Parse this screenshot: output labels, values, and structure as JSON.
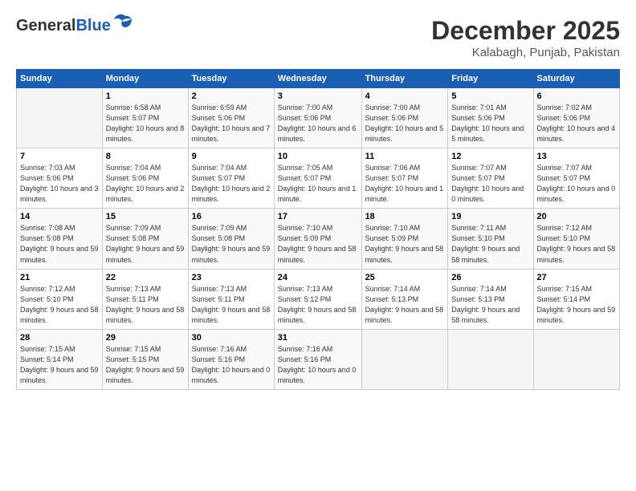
{
  "header": {
    "logo_general": "General",
    "logo_blue": "Blue",
    "month": "December 2025",
    "location": "Kalabagh, Punjab, Pakistan"
  },
  "days_of_week": [
    "Sunday",
    "Monday",
    "Tuesday",
    "Wednesday",
    "Thursday",
    "Friday",
    "Saturday"
  ],
  "weeks": [
    [
      {
        "num": "",
        "empty": true
      },
      {
        "num": "1",
        "sunrise": "Sunrise: 6:58 AM",
        "sunset": "Sunset: 5:07 PM",
        "daylight": "Daylight: 10 hours and 8 minutes."
      },
      {
        "num": "2",
        "sunrise": "Sunrise: 6:59 AM",
        "sunset": "Sunset: 5:06 PM",
        "daylight": "Daylight: 10 hours and 7 minutes."
      },
      {
        "num": "3",
        "sunrise": "Sunrise: 7:00 AM",
        "sunset": "Sunset: 5:06 PM",
        "daylight": "Daylight: 10 hours and 6 minutes."
      },
      {
        "num": "4",
        "sunrise": "Sunrise: 7:00 AM",
        "sunset": "Sunset: 5:06 PM",
        "daylight": "Daylight: 10 hours and 5 minutes."
      },
      {
        "num": "5",
        "sunrise": "Sunrise: 7:01 AM",
        "sunset": "Sunset: 5:06 PM",
        "daylight": "Daylight: 10 hours and 5 minutes."
      },
      {
        "num": "6",
        "sunrise": "Sunrise: 7:02 AM",
        "sunset": "Sunset: 5:06 PM",
        "daylight": "Daylight: 10 hours and 4 minutes."
      }
    ],
    [
      {
        "num": "7",
        "sunrise": "Sunrise: 7:03 AM",
        "sunset": "Sunset: 5:06 PM",
        "daylight": "Daylight: 10 hours and 3 minutes."
      },
      {
        "num": "8",
        "sunrise": "Sunrise: 7:04 AM",
        "sunset": "Sunset: 5:06 PM",
        "daylight": "Daylight: 10 hours and 2 minutes."
      },
      {
        "num": "9",
        "sunrise": "Sunrise: 7:04 AM",
        "sunset": "Sunset: 5:07 PM",
        "daylight": "Daylight: 10 hours and 2 minutes."
      },
      {
        "num": "10",
        "sunrise": "Sunrise: 7:05 AM",
        "sunset": "Sunset: 5:07 PM",
        "daylight": "Daylight: 10 hours and 1 minute."
      },
      {
        "num": "11",
        "sunrise": "Sunrise: 7:06 AM",
        "sunset": "Sunset: 5:07 PM",
        "daylight": "Daylight: 10 hours and 1 minute."
      },
      {
        "num": "12",
        "sunrise": "Sunrise: 7:07 AM",
        "sunset": "Sunset: 5:07 PM",
        "daylight": "Daylight: 10 hours and 0 minutes."
      },
      {
        "num": "13",
        "sunrise": "Sunrise: 7:07 AM",
        "sunset": "Sunset: 5:07 PM",
        "daylight": "Daylight: 10 hours and 0 minutes."
      }
    ],
    [
      {
        "num": "14",
        "sunrise": "Sunrise: 7:08 AM",
        "sunset": "Sunset: 5:08 PM",
        "daylight": "Daylight: 9 hours and 59 minutes."
      },
      {
        "num": "15",
        "sunrise": "Sunrise: 7:09 AM",
        "sunset": "Sunset: 5:08 PM",
        "daylight": "Daylight: 9 hours and 59 minutes."
      },
      {
        "num": "16",
        "sunrise": "Sunrise: 7:09 AM",
        "sunset": "Sunset: 5:08 PM",
        "daylight": "Daylight: 9 hours and 59 minutes."
      },
      {
        "num": "17",
        "sunrise": "Sunrise: 7:10 AM",
        "sunset": "Sunset: 5:09 PM",
        "daylight": "Daylight: 9 hours and 58 minutes."
      },
      {
        "num": "18",
        "sunrise": "Sunrise: 7:10 AM",
        "sunset": "Sunset: 5:09 PM",
        "daylight": "Daylight: 9 hours and 58 minutes."
      },
      {
        "num": "19",
        "sunrise": "Sunrise: 7:11 AM",
        "sunset": "Sunset: 5:10 PM",
        "daylight": "Daylight: 9 hours and 58 minutes."
      },
      {
        "num": "20",
        "sunrise": "Sunrise: 7:12 AM",
        "sunset": "Sunset: 5:10 PM",
        "daylight": "Daylight: 9 hours and 58 minutes."
      }
    ],
    [
      {
        "num": "21",
        "sunrise": "Sunrise: 7:12 AM",
        "sunset": "Sunset: 5:10 PM",
        "daylight": "Daylight: 9 hours and 58 minutes."
      },
      {
        "num": "22",
        "sunrise": "Sunrise: 7:13 AM",
        "sunset": "Sunset: 5:11 PM",
        "daylight": "Daylight: 9 hours and 58 minutes."
      },
      {
        "num": "23",
        "sunrise": "Sunrise: 7:13 AM",
        "sunset": "Sunset: 5:11 PM",
        "daylight": "Daylight: 9 hours and 58 minutes."
      },
      {
        "num": "24",
        "sunrise": "Sunrise: 7:13 AM",
        "sunset": "Sunset: 5:12 PM",
        "daylight": "Daylight: 9 hours and 58 minutes."
      },
      {
        "num": "25",
        "sunrise": "Sunrise: 7:14 AM",
        "sunset": "Sunset: 5:13 PM",
        "daylight": "Daylight: 9 hours and 58 minutes."
      },
      {
        "num": "26",
        "sunrise": "Sunrise: 7:14 AM",
        "sunset": "Sunset: 5:13 PM",
        "daylight": "Daylight: 9 hours and 58 minutes."
      },
      {
        "num": "27",
        "sunrise": "Sunrise: 7:15 AM",
        "sunset": "Sunset: 5:14 PM",
        "daylight": "Daylight: 9 hours and 59 minutes."
      }
    ],
    [
      {
        "num": "28",
        "sunrise": "Sunrise: 7:15 AM",
        "sunset": "Sunset: 5:14 PM",
        "daylight": "Daylight: 9 hours and 59 minutes."
      },
      {
        "num": "29",
        "sunrise": "Sunrise: 7:15 AM",
        "sunset": "Sunset: 5:15 PM",
        "daylight": "Daylight: 9 hours and 59 minutes."
      },
      {
        "num": "30",
        "sunrise": "Sunrise: 7:16 AM",
        "sunset": "Sunset: 5:16 PM",
        "daylight": "Daylight: 10 hours and 0 minutes."
      },
      {
        "num": "31",
        "sunrise": "Sunrise: 7:16 AM",
        "sunset": "Sunset: 5:16 PM",
        "daylight": "Daylight: 10 hours and 0 minutes."
      },
      {
        "num": "",
        "empty": true
      },
      {
        "num": "",
        "empty": true
      },
      {
        "num": "",
        "empty": true
      }
    ]
  ]
}
